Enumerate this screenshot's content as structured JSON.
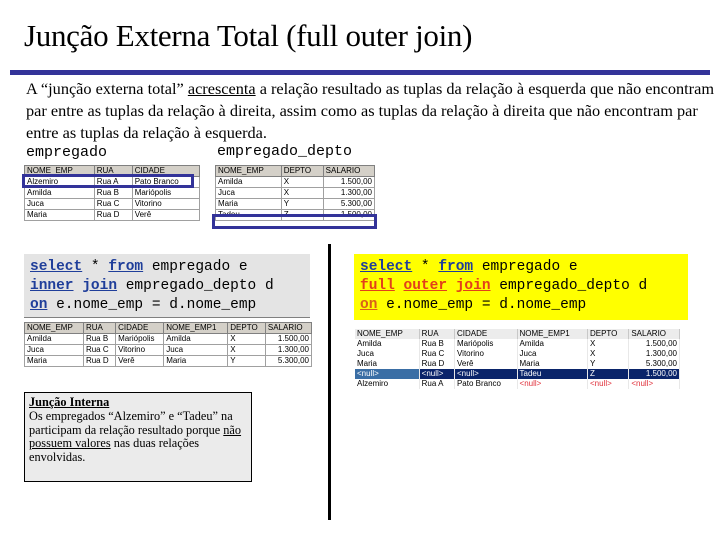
{
  "title": "Junção Externa Total (full outer join)",
  "intro": {
    "before": "A “junção externa total” ",
    "underlined": "acrescenta",
    "after": " a relação resultado as tuplas da relação à esquerda que não encontram par entre as tuplas da relação à direita, assim como as tuplas da relação à direita que não encontram par entre as tuplas da relação à esquerda."
  },
  "colors": {
    "accent": "#333399",
    "sql_inner_bg": "#e4e4e4",
    "sql_outer_bg": "#ffff00",
    "selected_row": "#0a246a",
    "null_text": "#e0303a"
  },
  "empregado": {
    "label": "empregado",
    "columns": [
      "NOME_EMP",
      "RUA",
      "CIDADE"
    ],
    "rows": [
      [
        "Alzemiro",
        "Rua A",
        "Pato Branco"
      ],
      [
        "Amilda",
        "Rua B",
        "Mariópolis"
      ],
      [
        "Juca",
        "Rua C",
        "Vitorino"
      ],
      [
        "Maria",
        "Rua D",
        "Verê"
      ]
    ],
    "highlighted_row": 0
  },
  "empregado_depto": {
    "label": "empregado_depto",
    "columns": [
      "NOME_EMP",
      "DEPTO",
      "SALARIO"
    ],
    "rows": [
      [
        "Amilda",
        "X",
        "1.500,00"
      ],
      [
        "Juca",
        "X",
        "1.300,00"
      ],
      [
        "Maria",
        "Y",
        "5.300,00"
      ],
      [
        "Tadeu",
        "Z",
        "1.500,00"
      ]
    ],
    "highlighted_row": 3
  },
  "sql_inner": {
    "kw_select": "select",
    "star": " * ",
    "kw_from": "from",
    "line1_rest": " empregado e",
    "kw_inner": "inner",
    "kw_join": "join",
    "line2_rest": " empregado_depto d",
    "kw_on": "on",
    "line3_rest": " e.nome_emp = d.nome_emp"
  },
  "sql_outer": {
    "kw_select": "select",
    "star": " * ",
    "kw_from": "from",
    "line1_rest": " empregado e",
    "kw_full": "full",
    "kw_outer": "outer",
    "kw_join": "join",
    "line2_rest": " empregado_depto d",
    "kw_on": "on",
    "line3_rest": " e.nome_emp = d.nome_emp"
  },
  "inner_result": {
    "columns": [
      "NOME_EMP",
      "RUA",
      "CIDADE",
      "NOME_EMP1",
      "DEPTO",
      "SALARIO"
    ],
    "rows": [
      [
        "Amilda",
        "Rua B",
        "Mariópolis",
        "Amilda",
        "X",
        "1.500,00"
      ],
      [
        "Juca",
        "Rua C",
        "Vitorino",
        "Juca",
        "X",
        "1.300,00"
      ],
      [
        "Maria",
        "Rua D",
        "Verê",
        "Maria",
        "Y",
        "5.300,00"
      ]
    ]
  },
  "outer_result": {
    "columns": [
      "NOME_EMP",
      "RUA",
      "CIDADE",
      "NOME_EMP1",
      "DEPTO",
      "SALARIO"
    ],
    "rows": [
      [
        "Amilda",
        "Rua B",
        "Mariópolis",
        "Amilda",
        "X",
        "1.500,00"
      ],
      [
        "Juca",
        "Rua C",
        "Vitorino",
        "Juca",
        "X",
        "1.300,00"
      ],
      [
        "Maria",
        "Rua D",
        "Verê",
        "Maria",
        "Y",
        "5.300,00"
      ],
      [
        "<null>",
        "<null>",
        "<null>",
        "Tadeu",
        "Z",
        "1.500,00"
      ],
      [
        "Alzemiro",
        "Rua A",
        "Pato Branco",
        "<null>",
        "<null>",
        "<null>"
      ]
    ],
    "selected_row": 3,
    "null_token": "<null>"
  },
  "note": {
    "title": "Junção Interna",
    "line_before": "Os empregados “Alzemiro” e “Tadeu” na participam da relação resultado porque ",
    "underlined": "não possuem valores",
    "line_after": " nas duas relações envolvidas."
  }
}
